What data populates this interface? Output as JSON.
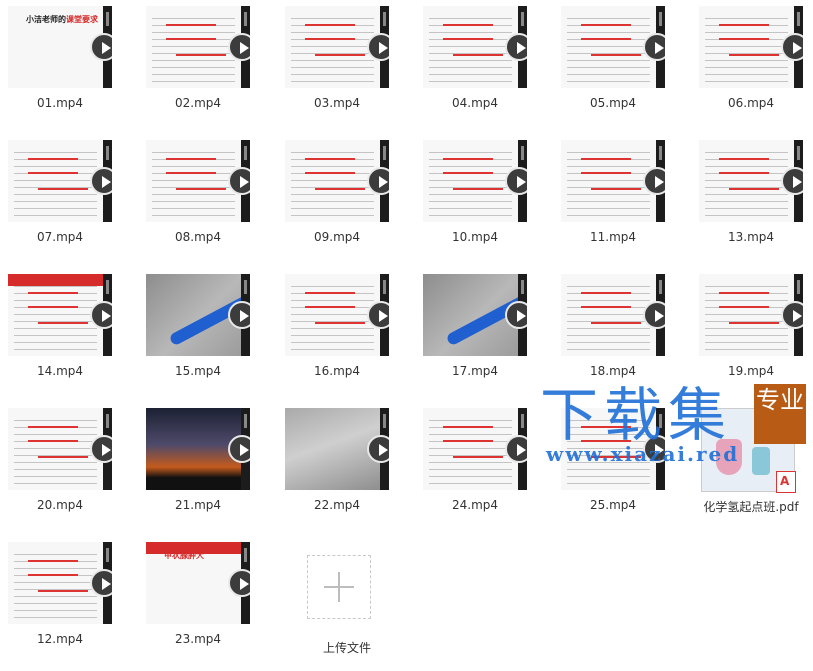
{
  "files": [
    {
      "name": "01.mp4",
      "type": "video",
      "thumb": "slide",
      "title_pre": "小洁老师的",
      "title_hl": "课堂要求"
    },
    {
      "name": "02.mp4",
      "type": "video",
      "thumb": "doc"
    },
    {
      "name": "03.mp4",
      "type": "video",
      "thumb": "doc"
    },
    {
      "name": "04.mp4",
      "type": "video",
      "thumb": "doc"
    },
    {
      "name": "05.mp4",
      "type": "video",
      "thumb": "doc"
    },
    {
      "name": "06.mp4",
      "type": "video",
      "thumb": "doc"
    },
    {
      "name": "07.mp4",
      "type": "video",
      "thumb": "doc"
    },
    {
      "name": "08.mp4",
      "type": "video",
      "thumb": "doc"
    },
    {
      "name": "09.mp4",
      "type": "video",
      "thumb": "doc"
    },
    {
      "name": "10.mp4",
      "type": "video",
      "thumb": "doc"
    },
    {
      "name": "11.mp4",
      "type": "video",
      "thumb": "doc"
    },
    {
      "name": "13.mp4",
      "type": "video",
      "thumb": "doc"
    },
    {
      "name": "14.mp4",
      "type": "video",
      "thumb": "slide2"
    },
    {
      "name": "15.mp4",
      "type": "video",
      "thumb": "photo-pen"
    },
    {
      "name": "16.mp4",
      "type": "video",
      "thumb": "doc"
    },
    {
      "name": "17.mp4",
      "type": "video",
      "thumb": "photo-pen"
    },
    {
      "name": "18.mp4",
      "type": "video",
      "thumb": "doc"
    },
    {
      "name": "19.mp4",
      "type": "video",
      "thumb": "doc"
    },
    {
      "name": "20.mp4",
      "type": "video",
      "thumb": "doc"
    },
    {
      "name": "21.mp4",
      "type": "video",
      "thumb": "photo-night"
    },
    {
      "name": "22.mp4",
      "type": "video",
      "thumb": "photo-gray"
    },
    {
      "name": "24.mp4",
      "type": "video",
      "thumb": "doc"
    },
    {
      "name": "25.mp4",
      "type": "video",
      "thumb": "doc"
    },
    {
      "name": "化学氢起点班.pdf",
      "type": "pdf"
    },
    {
      "name": "12.mp4",
      "type": "video",
      "thumb": "doc"
    },
    {
      "name": "23.mp4",
      "type": "video",
      "thumb": "slide3",
      "title_hl": "甲状腺肿大"
    }
  ],
  "upload": {
    "label": "上传文件"
  },
  "watermark": {
    "big": "下载集",
    "url": "www.xiazai.red",
    "seal": "专业"
  }
}
